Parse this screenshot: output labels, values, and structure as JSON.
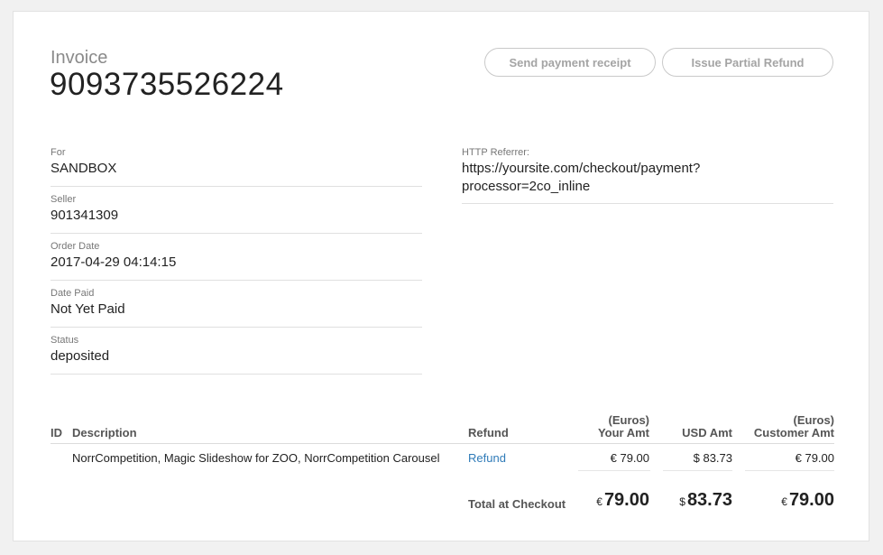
{
  "invoice": {
    "label": "Invoice",
    "number": "9093735526224"
  },
  "actions": {
    "send_receipt": "Send payment receipt",
    "partial_refund": "Issue Partial Refund"
  },
  "details": {
    "for_label": "For",
    "for_value": "SANDBOX",
    "seller_label": "Seller",
    "seller_value": "901341309",
    "order_date_label": "Order Date",
    "order_date_value": "2017-04-29 04:14:15",
    "date_paid_label": "Date Paid",
    "date_paid_value": "Not Yet Paid",
    "status_label": "Status",
    "status_value": "deposited",
    "referrer_label": "HTTP Referrer:",
    "referrer_line1": "https://yoursite.com/checkout/payment?",
    "referrer_line2": "processor=2co_inline"
  },
  "table": {
    "headers": {
      "id": "ID",
      "description": "Description",
      "refund": "Refund",
      "your_amt_line1": "(Euros)",
      "your_amt_line2": "Your Amt",
      "usd_amt": "USD Amt",
      "customer_amt_line1": "(Euros)",
      "customer_amt_line2": "Customer Amt"
    },
    "rows": [
      {
        "id": "",
        "description": "NorrCompetition, Magic Slideshow for ZOO, NorrCompetition Carousel",
        "refund": "Refund",
        "your_amt": "€ 79.00",
        "usd_amt": "$ 83.73",
        "customer_amt": "€ 79.00"
      }
    ],
    "total": {
      "label": "Total at Checkout",
      "your_symbol": "€",
      "your_value": "79.00",
      "usd_symbol": "$",
      "usd_value": "83.73",
      "customer_symbol": "€",
      "customer_value": "79.00"
    }
  }
}
